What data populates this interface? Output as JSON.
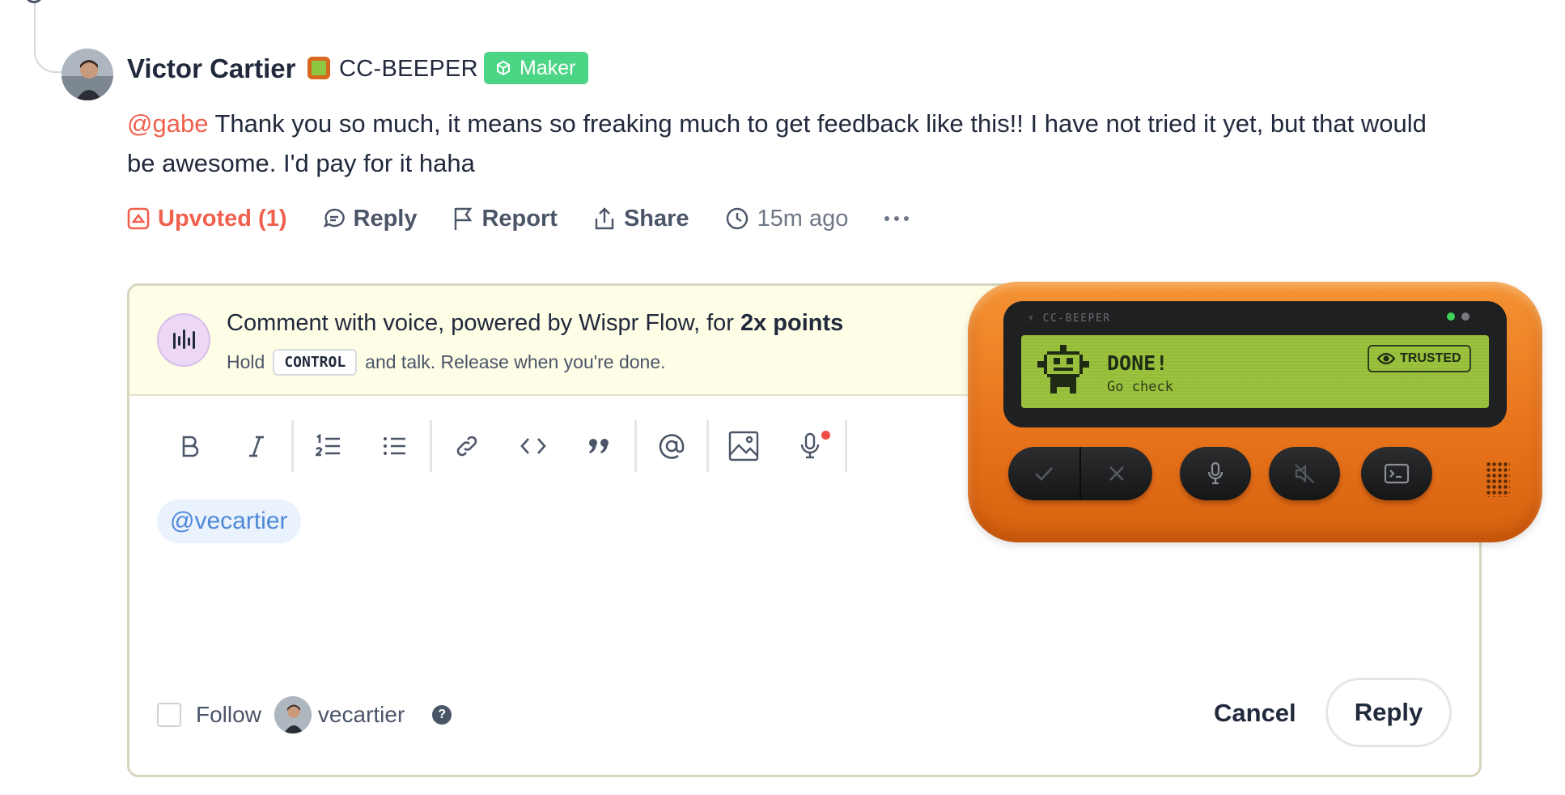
{
  "comment": {
    "author": "Victor Cartier",
    "product": "CC-BEEPER",
    "badge": "Maker",
    "mention": "@gabe",
    "text": " Thank you so much, it means so freaking much to get feedback like this!! I have not tried it yet, but that would be awesome. I'd pay for it haha"
  },
  "actions": {
    "upvote": "Upvoted (1)",
    "reply": "Reply",
    "report": "Report",
    "share": "Share",
    "time": "15m ago",
    "more": "···"
  },
  "voice": {
    "title_prefix": "Comment with voice, powered by Wispr Flow, for ",
    "title_bold": "2x points",
    "sub_before": "Hold",
    "key": "CONTROL",
    "sub_after": "and talk. Release when you're done."
  },
  "toolbar": [
    "bold-icon",
    "italic-icon",
    "ordered-list-icon",
    "bullet-list-icon",
    "link-icon",
    "code-icon",
    "quote-icon",
    "at-mention-icon",
    "image-icon",
    "microphone-icon"
  ],
  "editor": {
    "mention": "@vecartier"
  },
  "footer": {
    "follow": "Follow",
    "username": "vecartier",
    "help": "?",
    "cancel": "Cancel",
    "reply": "Reply"
  },
  "beeper": {
    "brand": "CC-BEEPER",
    "status": "DONE!",
    "sub": "Go check",
    "trusted": "TRUSTED"
  },
  "colors": {
    "accent": "#f0604d",
    "maker_green": "#4cd584",
    "mention_blue": "#4e88d8",
    "banner_bg": "#fefde6",
    "beeper_orange": "#e8741c",
    "screen_green": "#9cc33d"
  }
}
